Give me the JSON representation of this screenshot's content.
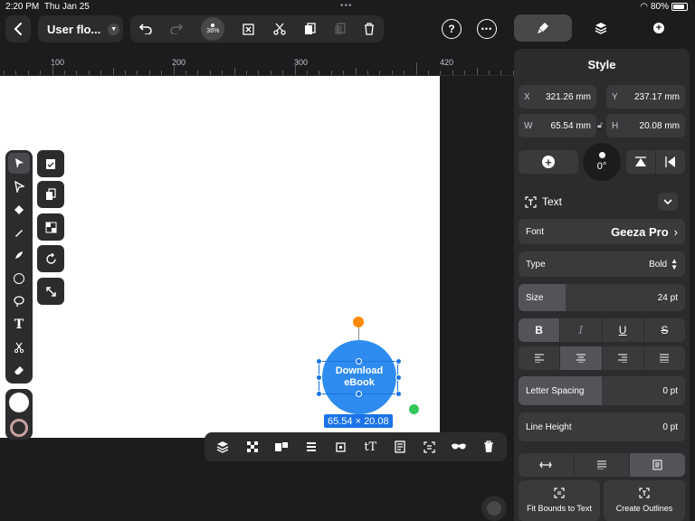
{
  "status": {
    "time": "2:20 PM",
    "date": "Thu Jan 25",
    "battery": "80%"
  },
  "toolbar": {
    "doc_title": "User flo...",
    "zoom": "36%"
  },
  "panel_tabs": [
    "brush-icon",
    "layers-icon",
    "plus-icon"
  ],
  "ruler": {
    "labels": [
      "100",
      "200",
      "300",
      "420"
    ]
  },
  "canvas": {
    "button_text_line1": "Download",
    "button_text_line2": "eBook",
    "size_label": "65.54 × 20.08",
    "accent": "#2e8cf0"
  },
  "style_panel": {
    "title": "Style",
    "x_label": "X",
    "x_value": "321.26 mm",
    "y_label": "Y",
    "y_value": "237.17 mm",
    "w_label": "W",
    "w_value": "65.54 mm",
    "h_label": "H",
    "h_value": "20.08 mm",
    "rotation": "0°",
    "text_section": "Text",
    "font_label": "Font",
    "font_value": "Geeza Pro",
    "type_label": "Type",
    "type_value": "Bold",
    "size_label": "Size",
    "size_value": "24 pt",
    "style_buttons": [
      "B",
      "I",
      "U",
      "S"
    ],
    "letter_spacing_label": "Letter Spacing",
    "letter_spacing_value": "0 pt",
    "line_height_label": "Line Height",
    "line_height_value": "0 pt",
    "fit_bounds": "Fit Bounds to Text",
    "create_outlines": "Create Outlines"
  },
  "colors": {
    "accent": "#2e8cf0",
    "orange": "#ff8a00",
    "green": "#34c759"
  }
}
